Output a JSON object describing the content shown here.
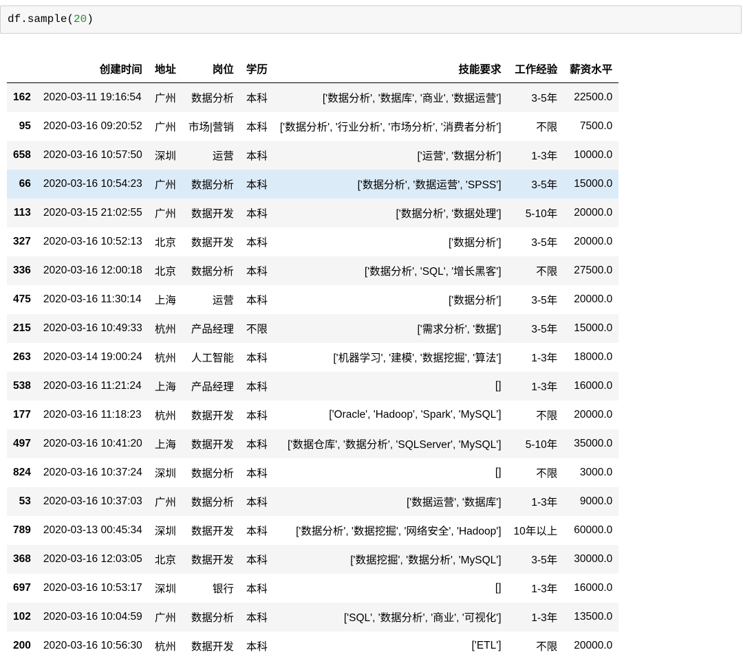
{
  "code": {
    "prefix": "df.sample(",
    "arg": "20",
    "suffix": ")"
  },
  "table": {
    "columns": [
      "",
      "创建时间",
      "地址",
      "岗位",
      "学历",
      "技能要求",
      "工作经验",
      "薪资水平"
    ],
    "rows": [
      [
        "162",
        "2020-03-11 19:16:54",
        "广州",
        "数据分析",
        "本科",
        "['数据分析', '数据库', '商业', '数据运营']",
        "3-5年",
        "22500.0"
      ],
      [
        "95",
        "2020-03-16 09:20:52",
        "广州",
        "市场|营销",
        "本科",
        "['数据分析', '行业分析', '市场分析', '消费者分析']",
        "不限",
        "7500.0"
      ],
      [
        "658",
        "2020-03-16 10:57:50",
        "深圳",
        "运营",
        "本科",
        "['运营', '数据分析']",
        "1-3年",
        "10000.0"
      ],
      [
        "66",
        "2020-03-16 10:54:23",
        "广州",
        "数据分析",
        "本科",
        "['数据分析', '数据运营', 'SPSS']",
        "3-5年",
        "15000.0"
      ],
      [
        "113",
        "2020-03-15 21:02:55",
        "广州",
        "数据开发",
        "本科",
        "['数据分析', '数据处理']",
        "5-10年",
        "20000.0"
      ],
      [
        "327",
        "2020-03-16 10:52:13",
        "北京",
        "数据开发",
        "本科",
        "['数据分析']",
        "3-5年",
        "20000.0"
      ],
      [
        "336",
        "2020-03-16 12:00:18",
        "北京",
        "数据分析",
        "本科",
        "['数据分析', 'SQL', '增长黑客']",
        "不限",
        "27500.0"
      ],
      [
        "475",
        "2020-03-16 11:30:14",
        "上海",
        "运营",
        "本科",
        "['数据分析']",
        "3-5年",
        "20000.0"
      ],
      [
        "215",
        "2020-03-16 10:49:33",
        "杭州",
        "产品经理",
        "不限",
        "['需求分析', '数据']",
        "3-5年",
        "15000.0"
      ],
      [
        "263",
        "2020-03-14 19:00:24",
        "杭州",
        "人工智能",
        "本科",
        "['机器学习', '建模', '数据挖掘', '算法']",
        "1-3年",
        "18000.0"
      ],
      [
        "538",
        "2020-03-16 11:21:24",
        "上海",
        "产品经理",
        "本科",
        "[]",
        "1-3年",
        "16000.0"
      ],
      [
        "177",
        "2020-03-16 11:18:23",
        "杭州",
        "数据开发",
        "本科",
        "['Oracle', 'Hadoop', 'Spark', 'MySQL']",
        "不限",
        "20000.0"
      ],
      [
        "497",
        "2020-03-16 10:41:20",
        "上海",
        "数据开发",
        "本科",
        "['数据仓库', '数据分析', 'SQLServer', 'MySQL']",
        "5-10年",
        "35000.0"
      ],
      [
        "824",
        "2020-03-16 10:37:24",
        "深圳",
        "数据分析",
        "本科",
        "[]",
        "不限",
        "3000.0"
      ],
      [
        "53",
        "2020-03-16 10:37:03",
        "广州",
        "数据分析",
        "本科",
        "['数据运营', '数据库']",
        "1-3年",
        "9000.0"
      ],
      [
        "789",
        "2020-03-13 00:45:34",
        "深圳",
        "数据开发",
        "本科",
        "['数据分析', '数据挖掘', '网络安全', 'Hadoop']",
        "10年以上",
        "60000.0"
      ],
      [
        "368",
        "2020-03-16 12:03:05",
        "北京",
        "数据开发",
        "本科",
        "['数据挖掘', '数据分析', 'MySQL']",
        "3-5年",
        "30000.0"
      ],
      [
        "697",
        "2020-03-16 10:53:17",
        "深圳",
        "银行",
        "本科",
        "[]",
        "1-3年",
        "16000.0"
      ],
      [
        "102",
        "2020-03-16 10:04:59",
        "广州",
        "数据分析",
        "本科",
        "['SQL', '数据分析', '商业', '可视化']",
        "1-3年",
        "13500.0"
      ],
      [
        "200",
        "2020-03-16 10:56:30",
        "杭州",
        "数据开发",
        "本科",
        "['ETL']",
        "不限",
        "20000.0"
      ]
    ],
    "hovered_row": 3
  }
}
